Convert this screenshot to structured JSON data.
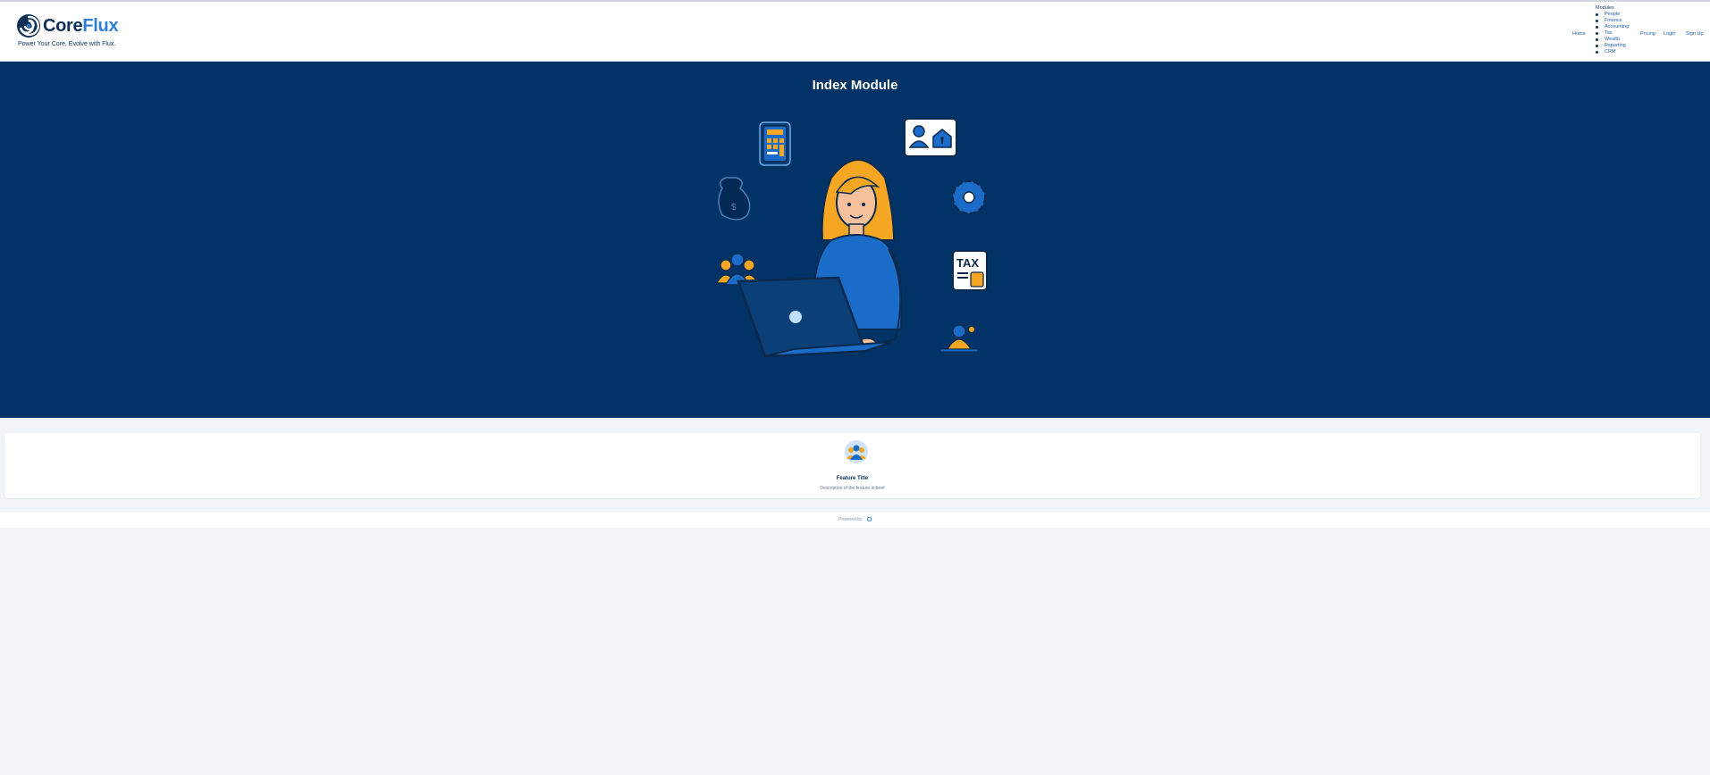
{
  "brand": {
    "name_core": "Core",
    "name_flux": "Flux",
    "tagline": "Power Your Core. Evolve with Flux.",
    "colors": {
      "navy": "#0e2f56",
      "accent": "#2d7fd6",
      "hero_bg": "#023366",
      "page_bg": "#f2f5f8"
    }
  },
  "nav": {
    "home": "Home",
    "modules_label": "Modules",
    "modules": [
      "People",
      "Finance",
      "Accounting",
      "Tax",
      "Wealth",
      "Reporting",
      "CRM"
    ],
    "pricing": "Pricing",
    "login": "Login",
    "signup": "Sign Up"
  },
  "hero": {
    "title": "Index Module",
    "illustration": "woman-using-laptop-with-module-icons"
  },
  "hero_icons": [
    "calculator-icon",
    "id-badge-house-icon",
    "money-bag-icon",
    "gear-icon",
    "people-group-icon",
    "tax-document-icon",
    "user-presenter-icon"
  ],
  "feature": {
    "icon": "people-group-icon",
    "title": "Feature Title",
    "description": "Description of the feature in brief"
  },
  "footer": {
    "powered_by": "Powered by",
    "icon": "coreflux-mark-icon"
  }
}
